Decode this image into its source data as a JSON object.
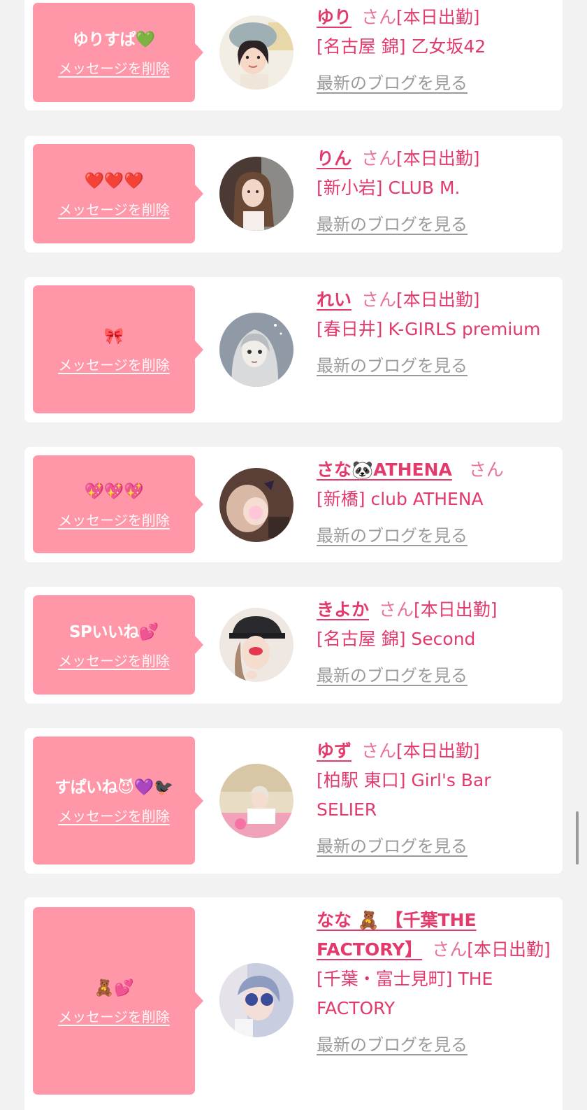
{
  "colors": {
    "background": "#f2f2f2",
    "card": "#ffffff",
    "bubble": "#ff97a8",
    "accent_text": "#e23a6b",
    "link_gray": "#9a9a9a"
  },
  "common": {
    "delete_label": "メッセージを削除",
    "san_label": "さん",
    "blog_label": "最新のブログを見る"
  },
  "messages": [
    {
      "bubble_text": "ゆりすぱ💚",
      "name": "ゆり",
      "status": "[本日出勤]",
      "shop": "[名古屋 錦] 乙女坂42",
      "avatar": "photo-avatar"
    },
    {
      "bubble_text": "❤️❤️❤️",
      "name": "りん",
      "status": "[本日出勤]",
      "shop": "[新小岩] CLUB M.",
      "avatar": "photo-avatar"
    },
    {
      "bubble_text": "🎀",
      "name": "れい",
      "status": "[本日出勤]",
      "shop": "[春日井] K-GIRLS premium",
      "avatar": "illustration-avatar"
    },
    {
      "bubble_text": "💖💖💖",
      "name": "さな🐼ATHENA",
      "status": "",
      "shop": "[新橋] club ATHENA",
      "avatar": "photo-avatar"
    },
    {
      "bubble_text": "SPいいね💕",
      "name": "きよか",
      "status": "[本日出勤]",
      "shop": "[名古屋 錦] Second",
      "avatar": "photo-avatar"
    },
    {
      "bubble_text": "すぱいね😈💜🐦‍⬛",
      "name": "ゆず",
      "status": "[本日出勤]",
      "shop": "[柏駅 東口] Girl's Bar SELIER",
      "avatar": "photo-avatar"
    },
    {
      "bubble_text": "🧸💕",
      "name": "なな 🧸 【千葉THE FACTORY】",
      "status": "[本日出勤]",
      "shop": "[千葉・富士見町] THE FACTORY",
      "avatar": "photo-avatar"
    }
  ]
}
